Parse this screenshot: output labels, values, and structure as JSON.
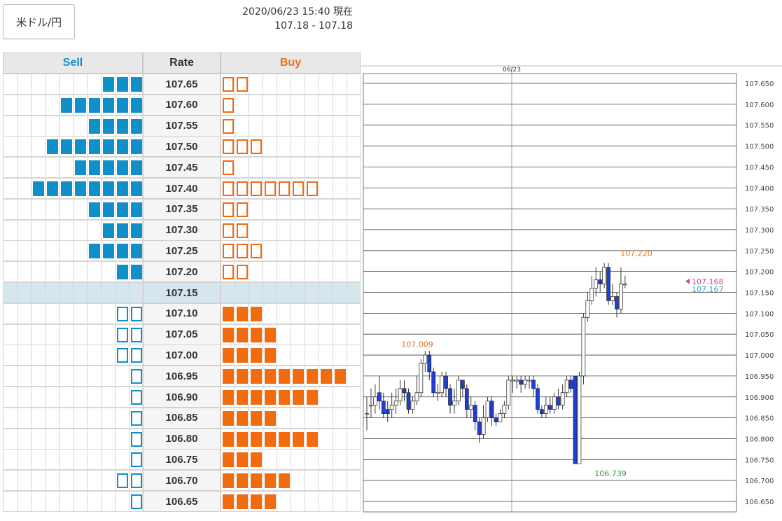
{
  "pair": {
    "label": "米ドル/円"
  },
  "header": {
    "datetime": "2020/06/23 15:40 現在",
    "bid_ask": "107.18 - 107.18"
  },
  "orderbook": {
    "columns": {
      "sell": "Sell",
      "rate": "Rate",
      "buy": "Buy"
    },
    "colors": {
      "sell": "#1090c8",
      "buy": "#f26b0f",
      "current_row": "#d6e6ee"
    },
    "rows": [
      {
        "rate": "107.65",
        "sell": 3,
        "sell_style": "filled",
        "buy": 2,
        "buy_style": "outline"
      },
      {
        "rate": "107.60",
        "sell": 6,
        "sell_style": "filled",
        "buy": 1,
        "buy_style": "outline"
      },
      {
        "rate": "107.55",
        "sell": 4,
        "sell_style": "filled",
        "buy": 1,
        "buy_style": "outline"
      },
      {
        "rate": "107.50",
        "sell": 7,
        "sell_style": "filled",
        "buy": 3,
        "buy_style": "outline"
      },
      {
        "rate": "107.45",
        "sell": 5,
        "sell_style": "filled",
        "buy": 1,
        "buy_style": "outline"
      },
      {
        "rate": "107.40",
        "sell": 8,
        "sell_style": "filled",
        "buy": 7,
        "buy_style": "outline"
      },
      {
        "rate": "107.35",
        "sell": 4,
        "sell_style": "filled",
        "buy": 2,
        "buy_style": "outline"
      },
      {
        "rate": "107.30",
        "sell": 3,
        "sell_style": "filled",
        "buy": 2,
        "buy_style": "outline"
      },
      {
        "rate": "107.25",
        "sell": 4,
        "sell_style": "filled",
        "buy": 3,
        "buy_style": "outline"
      },
      {
        "rate": "107.20",
        "sell": 2,
        "sell_style": "filled",
        "buy": 2,
        "buy_style": "outline"
      },
      {
        "rate": "107.15",
        "sell": 0,
        "sell_style": "filled",
        "buy": 0,
        "buy_style": "filled",
        "current": true
      },
      {
        "rate": "107.10",
        "sell": 2,
        "sell_style": "outline",
        "buy": 3,
        "buy_style": "filled"
      },
      {
        "rate": "107.05",
        "sell": 2,
        "sell_style": "outline",
        "buy": 4,
        "buy_style": "filled"
      },
      {
        "rate": "107.00",
        "sell": 2,
        "sell_style": "outline",
        "buy": 4,
        "buy_style": "filled"
      },
      {
        "rate": "106.95",
        "sell": 1,
        "sell_style": "outline",
        "buy": 9,
        "buy_style": "filled"
      },
      {
        "rate": "106.90",
        "sell": 1,
        "sell_style": "outline",
        "buy": 7,
        "buy_style": "filled"
      },
      {
        "rate": "106.85",
        "sell": 1,
        "sell_style": "outline",
        "buy": 4,
        "buy_style": "filled"
      },
      {
        "rate": "106.80",
        "sell": 1,
        "sell_style": "outline",
        "buy": 7,
        "buy_style": "filled"
      },
      {
        "rate": "106.75",
        "sell": 1,
        "sell_style": "outline",
        "buy": 3,
        "buy_style": "filled"
      },
      {
        "rate": "106.70",
        "sell": 2,
        "sell_style": "outline",
        "buy": 5,
        "buy_style": "filled"
      },
      {
        "rate": "106.65",
        "sell": 1,
        "sell_style": "outline",
        "buy": 4,
        "buy_style": "filled"
      }
    ]
  },
  "chart": {
    "date_label": "06/23",
    "y_labels": [
      "107.650",
      "107.600",
      "107.550",
      "107.500",
      "107.450",
      "107.400",
      "107.350",
      "107.300",
      "107.250",
      "107.200",
      "107.150",
      "107.100",
      "107.050",
      "107.000",
      "106.950",
      "106.900",
      "106.850",
      "106.800",
      "106.750",
      "106.700",
      "106.650"
    ],
    "annotations": {
      "high_left": "107.009",
      "high_right": "107.220",
      "low": "106.739",
      "price_a": "107.168",
      "price_b": "107.167"
    },
    "colors": {
      "bear": "#1d3fd8",
      "bull": "#ffffff",
      "high_text": "#e07020",
      "low_text": "#20a020",
      "price_a": "#e0407a",
      "price_b": "#2aa8d8"
    }
  },
  "chart_data": {
    "type": "candlestick",
    "ylim": [
      106.63,
      107.67
    ],
    "candles": [
      [
        106.86,
        106.86,
        106.82,
        106.9
      ],
      [
        106.88,
        106.88,
        106.85,
        106.92
      ],
      [
        106.88,
        106.9,
        106.86,
        106.93
      ],
      [
        106.91,
        106.89,
        106.87,
        106.95
      ],
      [
        106.89,
        106.86,
        106.85,
        106.91
      ],
      [
        106.87,
        106.86,
        106.84,
        106.89
      ],
      [
        106.87,
        106.88,
        106.85,
        106.91
      ],
      [
        106.88,
        106.89,
        106.86,
        106.92
      ],
      [
        106.89,
        106.92,
        106.88,
        106.94
      ],
      [
        106.92,
        106.91,
        106.89,
        106.94
      ],
      [
        106.91,
        106.87,
        106.86,
        106.92
      ],
      [
        106.87,
        106.89,
        106.86,
        106.9
      ],
      [
        106.89,
        106.91,
        106.88,
        106.95
      ],
      [
        106.91,
        106.98,
        106.9,
        106.99
      ],
      [
        106.98,
        107.0,
        106.96,
        107.01
      ],
      [
        107.0,
        106.96,
        106.94,
        107.01
      ],
      [
        106.96,
        106.91,
        106.9,
        106.97
      ],
      [
        106.91,
        106.91,
        106.89,
        106.93
      ],
      [
        106.91,
        106.95,
        106.9,
        106.96
      ],
      [
        106.95,
        106.92,
        106.9,
        106.96
      ],
      [
        106.92,
        106.88,
        106.86,
        106.93
      ],
      [
        106.88,
        106.89,
        106.86,
        106.92
      ],
      [
        106.89,
        106.94,
        106.88,
        106.95
      ],
      [
        106.94,
        106.92,
        106.9,
        106.94
      ],
      [
        106.92,
        106.87,
        106.85,
        106.93
      ],
      [
        106.87,
        106.88,
        106.85,
        106.9
      ],
      [
        106.88,
        106.84,
        106.82,
        106.89
      ],
      [
        106.84,
        106.81,
        106.79,
        106.85
      ],
      [
        106.81,
        106.85,
        106.8,
        106.88
      ],
      [
        106.85,
        106.89,
        106.84,
        106.9
      ],
      [
        106.89,
        106.85,
        106.83,
        106.9
      ],
      [
        106.85,
        106.84,
        106.83,
        106.86
      ],
      [
        106.84,
        106.86,
        106.84,
        106.87
      ],
      [
        106.86,
        106.88,
        106.85,
        106.89
      ],
      [
        106.88,
        106.94,
        106.87,
        106.95
      ],
      [
        106.94,
        106.94,
        106.91,
        106.95
      ],
      [
        106.94,
        106.94,
        106.92,
        106.95
      ],
      [
        106.94,
        106.93,
        106.91,
        106.95
      ],
      [
        106.93,
        106.94,
        106.92,
        106.95
      ],
      [
        106.94,
        106.94,
        106.92,
        106.95
      ],
      [
        106.94,
        106.92,
        106.9,
        106.95
      ],
      [
        106.92,
        106.87,
        106.86,
        106.93
      ],
      [
        106.87,
        106.86,
        106.85,
        106.88
      ],
      [
        106.86,
        106.88,
        106.85,
        106.9
      ],
      [
        106.88,
        106.87,
        106.86,
        106.9
      ],
      [
        106.87,
        106.9,
        106.86,
        106.91
      ],
      [
        106.9,
        106.88,
        106.87,
        106.92
      ],
      [
        106.88,
        106.91,
        106.87,
        106.93
      ],
      [
        106.91,
        106.94,
        106.9,
        106.95
      ],
      [
        106.94,
        106.92,
        106.91,
        106.95
      ],
      [
        106.95,
        106.74,
        106.74,
        106.95
      ],
      [
        106.74,
        106.95,
        106.74,
        106.96
      ],
      [
        106.95,
        107.09,
        106.93,
        107.1
      ],
      [
        107.09,
        107.13,
        107.08,
        107.15
      ],
      [
        107.13,
        107.16,
        107.12,
        107.19
      ],
      [
        107.16,
        107.18,
        107.14,
        107.21
      ],
      [
        107.18,
        107.17,
        107.15,
        107.2
      ],
      [
        107.17,
        107.21,
        107.16,
        107.22
      ],
      [
        107.21,
        107.13,
        107.12,
        107.22
      ],
      [
        107.13,
        107.14,
        107.12,
        107.17
      ],
      [
        107.14,
        107.11,
        107.09,
        107.15
      ],
      [
        107.11,
        107.17,
        107.1,
        107.21
      ],
      [
        107.17,
        107.17,
        107.16,
        107.19
      ]
    ]
  }
}
